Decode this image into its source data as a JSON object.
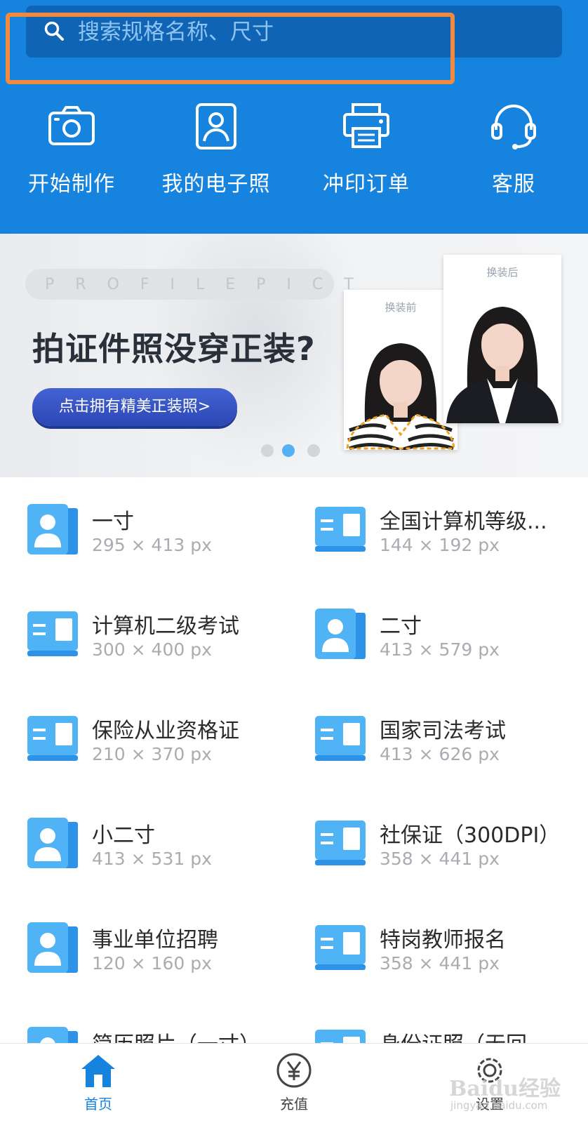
{
  "search": {
    "placeholder": "搜索规格名称、尺寸"
  },
  "quick_actions": [
    {
      "label": "开始制作",
      "icon": "camera-icon"
    },
    {
      "label": "我的电子照",
      "icon": "portrait-icon"
    },
    {
      "label": "冲印订单",
      "icon": "printer-icon"
    },
    {
      "label": "客服",
      "icon": "headset-icon"
    }
  ],
  "banner": {
    "watermark": "PROFILEPICT",
    "title": "拍证件照没穿正装?",
    "cta": "点击拥有精美正装照>",
    "before_label": "换装前",
    "after_label": "换装后",
    "active_dot": 2,
    "dot_count": 3
  },
  "specs": [
    {
      "name": "一寸",
      "size": "295 × 413 px",
      "icon": "portrait-card-icon"
    },
    {
      "name": "全国计算机等级...",
      "size": "144 × 192 px",
      "icon": "id-card-icon"
    },
    {
      "name": "计算机二级考试",
      "size": "300 × 400 px",
      "icon": "id-card-icon"
    },
    {
      "name": "二寸",
      "size": "413 × 579 px",
      "icon": "portrait-card-icon"
    },
    {
      "name": "保险从业资格证",
      "size": "210 × 370 px",
      "icon": "id-card-icon"
    },
    {
      "name": "国家司法考试",
      "size": "413 × 626 px",
      "icon": "id-card-icon"
    },
    {
      "name": "小二寸",
      "size": "413 × 531 px",
      "icon": "portrait-card-icon"
    },
    {
      "name": "社保证（300DPI）",
      "size": "358 × 441 px",
      "icon": "id-card-icon"
    },
    {
      "name": "事业单位招聘",
      "size": "120 × 160 px",
      "icon": "portrait-card-icon"
    },
    {
      "name": "特岗教师报名",
      "size": "358 × 441 px",
      "icon": "id-card-icon"
    },
    {
      "name": "简历照片（一寸）",
      "size": "",
      "icon": "portrait-card-icon"
    },
    {
      "name": "身份证照（无回",
      "size": "",
      "icon": "id-card-icon"
    }
  ],
  "bottom_nav": [
    {
      "label": "首页",
      "icon": "home-icon",
      "active": true
    },
    {
      "label": "充值",
      "icon": "yen-icon",
      "active": false
    },
    {
      "label": "设置",
      "icon": "gear-icon",
      "active": false
    }
  ],
  "watermark": {
    "logo": "Baidu经验",
    "url": "jingyan.baidu.com"
  },
  "colors": {
    "header_blue": "#1683de",
    "search_bg": "#1064b5",
    "highlight_orange": "#f08a40",
    "icon_blue": "#4fb3f6",
    "cta_blue": "#3553c4"
  }
}
